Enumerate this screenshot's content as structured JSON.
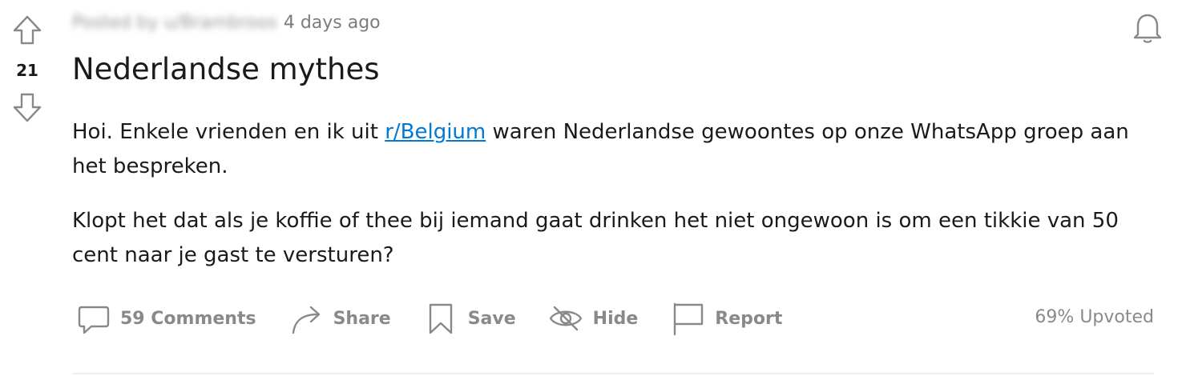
{
  "vote": {
    "score": "21",
    "upvote_icon": "arrow-up-icon",
    "downvote_icon": "arrow-down-icon"
  },
  "meta": {
    "posted_by": "Posted by u/Brambroos",
    "time": "4 days ago"
  },
  "notification_icon": "bell-icon",
  "post": {
    "title": "Nederlandse mythes",
    "para1_before": "Hoi. Enkele vrienden en ik uit ",
    "para1_link": "r/Belgium",
    "para1_after": " waren Nederlandse gewoontes op onze WhatsApp groep aan het bespreken.",
    "para2": "Klopt het dat als je koffie of thee bij iemand gaat drinken het niet ongewoon is om een tikkie van 50 cent naar je gast te versturen?"
  },
  "actions": {
    "comments": "59 Comments",
    "share": "Share",
    "save": "Save",
    "hide": "Hide",
    "report": "Report"
  },
  "upvoted": "69% Upvoted",
  "colors": {
    "link": "#0079d3",
    "muted": "#878a8c",
    "text": "#1a1a1b"
  }
}
